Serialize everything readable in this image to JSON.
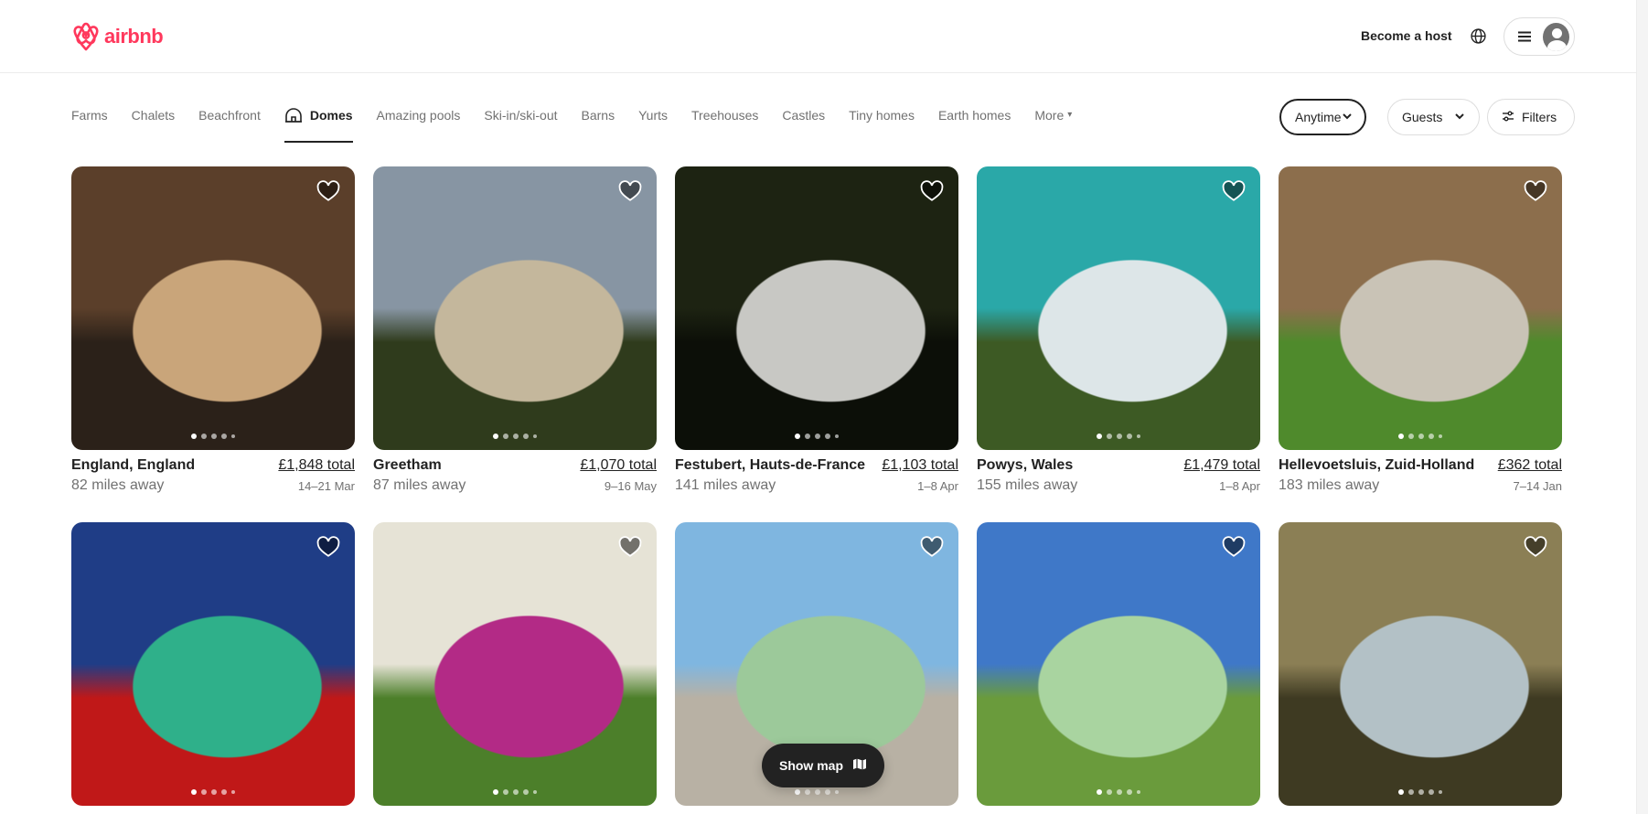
{
  "header": {
    "brand": "airbnb",
    "brand_color": "#ff385c",
    "host_label": "Become a host",
    "globe_icon": "globe-icon",
    "menu_icon": "hamburger-icon"
  },
  "categories": [
    {
      "label": "Farms",
      "active": false
    },
    {
      "label": "Chalets",
      "active": false
    },
    {
      "label": "Beachfront",
      "active": false
    },
    {
      "label": "Domes",
      "active": true,
      "icon": "dome-icon"
    },
    {
      "label": "Amazing pools",
      "active": false
    },
    {
      "label": "Ski-in/ski-out",
      "active": false
    },
    {
      "label": "Barns",
      "active": false
    },
    {
      "label": "Yurts",
      "active": false
    },
    {
      "label": "Treehouses",
      "active": false
    },
    {
      "label": "Castles",
      "active": false
    },
    {
      "label": "Tiny homes",
      "active": false
    },
    {
      "label": "Earth homes",
      "active": false
    },
    {
      "label": "More",
      "active": false
    }
  ],
  "filters": {
    "anytime": "Anytime",
    "guests": "Guests",
    "filters": "Filters"
  },
  "listings": [
    {
      "location": "England, England",
      "distance": "82 miles away",
      "price": "£1,848 total",
      "dates": "14–21 Mar",
      "image_desc": "dome interior with bed and window view",
      "palette": [
        "#5b3f2a",
        "#c9a57a",
        "#2b2119"
      ]
    },
    {
      "location": "Greetham",
      "distance": "87 miles away",
      "price": "£1,070 total",
      "dates": "9–16 May",
      "image_desc": "dome at sunset in field",
      "palette": [
        "#8795a3",
        "#c4b79c",
        "#2f3b1c"
      ]
    },
    {
      "location": "Festubert, Hauts-de-France",
      "distance": "141 miles away",
      "price": "£1,103 total",
      "dates": "1–8 Apr",
      "image_desc": "bubble dome at night",
      "palette": [
        "#1d2312",
        "#c8c8c4",
        "#0c0f08"
      ]
    },
    {
      "location": "Powys, Wales",
      "distance": "155 miles away",
      "price": "£1,479 total",
      "dates": "1–8 Apr",
      "image_desc": "teal geodesic dome on deck",
      "palette": [
        "#2aa8a8",
        "#dde6e8",
        "#3d5a24"
      ]
    },
    {
      "location": "Hellevoetsluis, Zuid-Holland",
      "distance": "183 miles away",
      "price": "£362 total",
      "dates": "7–14 Jan",
      "image_desc": "wooden dome with patio",
      "palette": [
        "#8c6e4c",
        "#c9c3b6",
        "#4f8a2c"
      ]
    },
    {
      "location": "",
      "distance": "",
      "price": "",
      "dates": "",
      "image_desc": "lit dome with hot tub at dusk",
      "palette": [
        "#1f3d86",
        "#2fb08a",
        "#c01818"
      ]
    },
    {
      "location": "",
      "distance": "",
      "price": "",
      "dates": "",
      "image_desc": "white and pink dome on grass",
      "palette": [
        "#e6e3d6",
        "#b32a86",
        "#4c7f2a"
      ]
    },
    {
      "location": "",
      "distance": "",
      "price": "",
      "dates": "",
      "image_desc": "green dome with deck and clouds",
      "palette": [
        "#7fb6e0",
        "#9cc99a",
        "#b8b1a4"
      ]
    },
    {
      "location": "",
      "distance": "",
      "price": "",
      "dates": "",
      "image_desc": "green dome on hillside",
      "palette": [
        "#3f78c8",
        "#a9d4a0",
        "#6a9b3c"
      ]
    },
    {
      "location": "",
      "distance": "",
      "price": "",
      "dates": "",
      "image_desc": "clear bubble dome in forest",
      "palette": [
        "#8b7f55",
        "#b3c1c6",
        "#3e3a22"
      ]
    }
  ],
  "show_map": {
    "label": "Show map",
    "icon": "map-icon"
  }
}
